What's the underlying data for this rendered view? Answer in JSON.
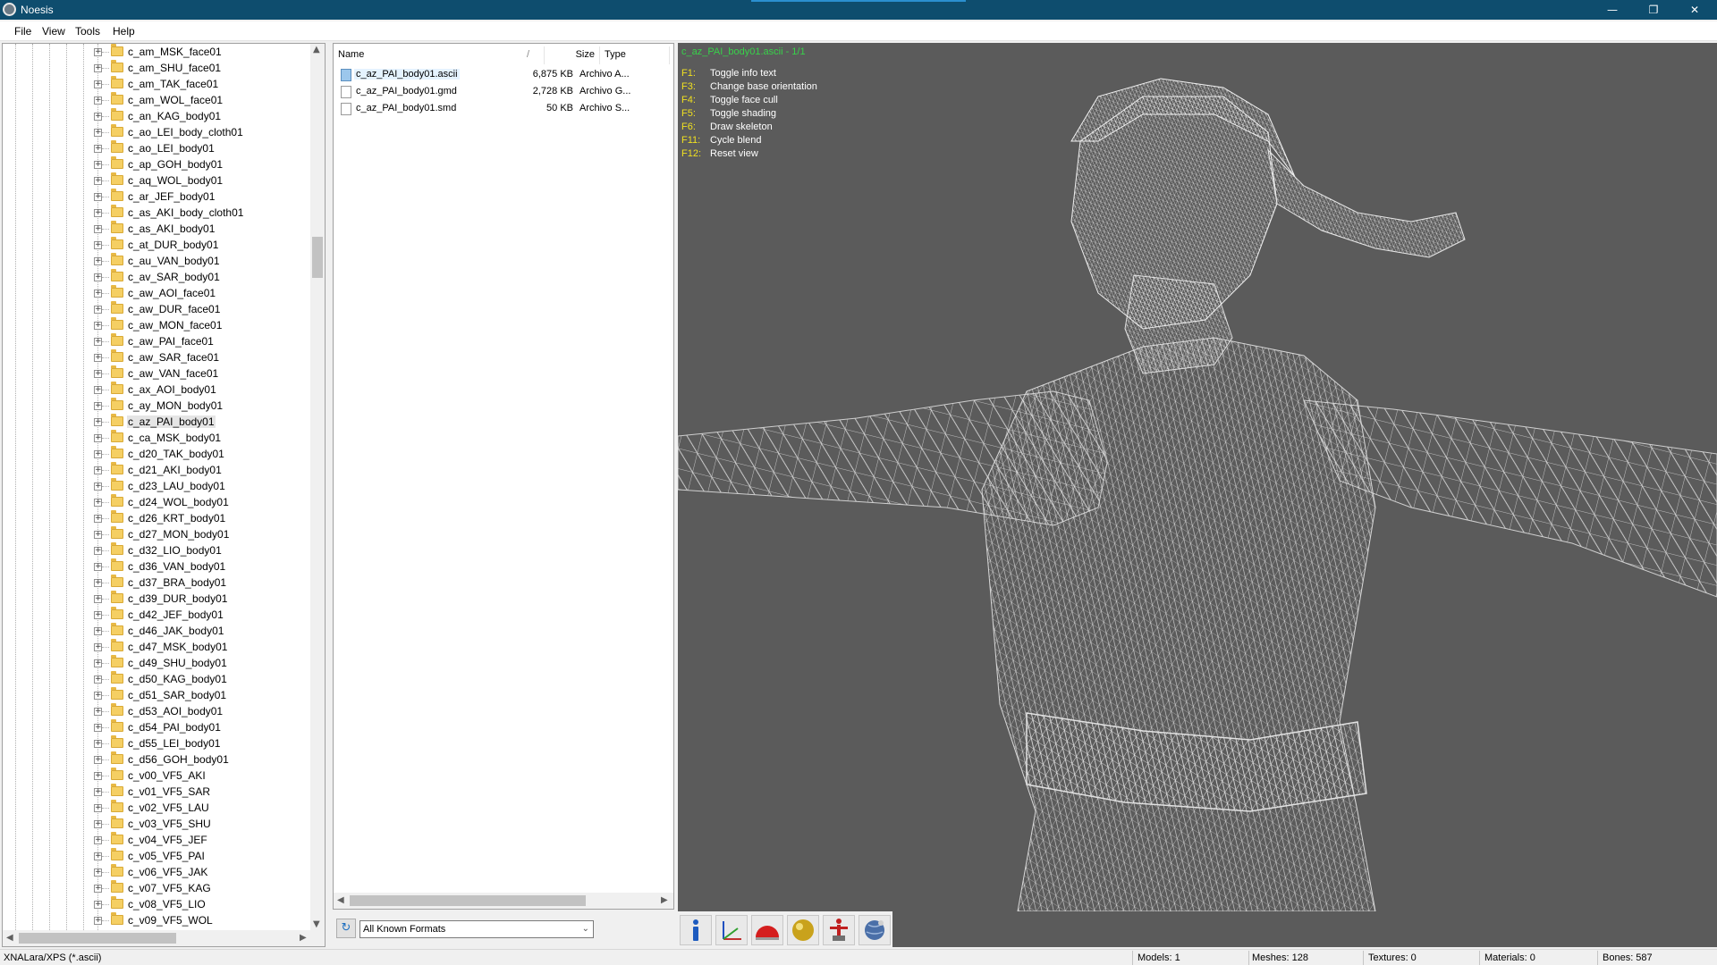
{
  "window": {
    "title": "Noesis",
    "minimize": "—",
    "restore": "❐",
    "close": "✕"
  },
  "menu": [
    "File",
    "View",
    "Tools",
    "Help"
  ],
  "tree": {
    "items": [
      "c_am_MSK_face01",
      "c_am_SHU_face01",
      "c_am_TAK_face01",
      "c_am_WOL_face01",
      "c_an_KAG_body01",
      "c_ao_LEI_body_cloth01",
      "c_ao_LEI_body01",
      "c_ap_GOH_body01",
      "c_aq_WOL_body01",
      "c_ar_JEF_body01",
      "c_as_AKI_body_cloth01",
      "c_as_AKI_body01",
      "c_at_DUR_body01",
      "c_au_VAN_body01",
      "c_av_SAR_body01",
      "c_aw_AOI_face01",
      "c_aw_DUR_face01",
      "c_aw_MON_face01",
      "c_aw_PAI_face01",
      "c_aw_SAR_face01",
      "c_aw_VAN_face01",
      "c_ax_AOI_body01",
      "c_ay_MON_body01",
      "c_az_PAI_body01",
      "c_ca_MSK_body01",
      "c_d20_TAK_body01",
      "c_d21_AKI_body01",
      "c_d23_LAU_body01",
      "c_d24_WOL_body01",
      "c_d26_KRT_body01",
      "c_d27_MON_body01",
      "c_d32_LIO_body01",
      "c_d36_VAN_body01",
      "c_d37_BRA_body01",
      "c_d39_DUR_body01",
      "c_d42_JEF_body01",
      "c_d46_JAK_body01",
      "c_d47_MSK_body01",
      "c_d49_SHU_body01",
      "c_d50_KAG_body01",
      "c_d51_SAR_body01",
      "c_d53_AOI_body01",
      "c_d54_PAI_body01",
      "c_d55_LEI_body01",
      "c_d56_GOH_body01",
      "c_v00_VF5_AKI",
      "c_v01_VF5_SAR",
      "c_v02_VF5_LAU",
      "c_v03_VF5_SHU",
      "c_v04_VF5_JEF",
      "c_v05_VF5_PAI",
      "c_v06_VF5_JAK",
      "c_v07_VF5_KAG",
      "c_v08_VF5_LIO",
      "c_v09_VF5_WOL"
    ],
    "selected": "c_az_PAI_body01",
    "expander": "+"
  },
  "files": {
    "columns": {
      "name": "Name",
      "size": "Size",
      "type": "Type",
      "sort_indicator": "/"
    },
    "rows": [
      {
        "name": "c_az_PAI_body01.ascii",
        "size": "6,875 KB",
        "type": "Archivo A..."
      },
      {
        "name": "c_az_PAI_body01.gmd",
        "size": "2,728 KB",
        "type": "Archivo G..."
      },
      {
        "name": "c_az_PAI_body01.smd",
        "size": "50 KB",
        "type": "Archivo S..."
      }
    ]
  },
  "format_filter": {
    "value": "All Known Formats",
    "refresh_icon": "↻"
  },
  "viewport": {
    "title": "c_az_PAI_body01.ascii - 1/1",
    "help": [
      {
        "key": "F1:",
        "desc": "Toggle info text"
      },
      {
        "key": "F3:",
        "desc": "Change base orientation"
      },
      {
        "key": "F4:",
        "desc": "Toggle face cull"
      },
      {
        "key": "F5:",
        "desc": "Toggle shading"
      },
      {
        "key": "F6:",
        "desc": "Draw skeleton"
      },
      {
        "key": "F11:",
        "desc": "Cycle blend"
      },
      {
        "key": "F12:",
        "desc": "Reset view"
      }
    ],
    "toolbar": [
      {
        "icon": "info-icon"
      },
      {
        "icon": "axes-icon"
      },
      {
        "icon": "red-dome-icon"
      },
      {
        "icon": "yellow-sphere-icon"
      },
      {
        "icon": "skeleton-icon"
      },
      {
        "icon": "globe-icon"
      }
    ]
  },
  "status": {
    "format": "XNALara/XPS (*.ascii)",
    "models": "Models: 1",
    "meshes": "Meshes: 128",
    "textures": "Textures: 0",
    "materials": "Materials: 0",
    "bones": "Bones: 587"
  },
  "colors": {
    "titlebar": "#0e4d6e",
    "viewport_bg": "#5b5b5b",
    "help_key": "#f0e020",
    "viewport_title": "#38d24a"
  }
}
